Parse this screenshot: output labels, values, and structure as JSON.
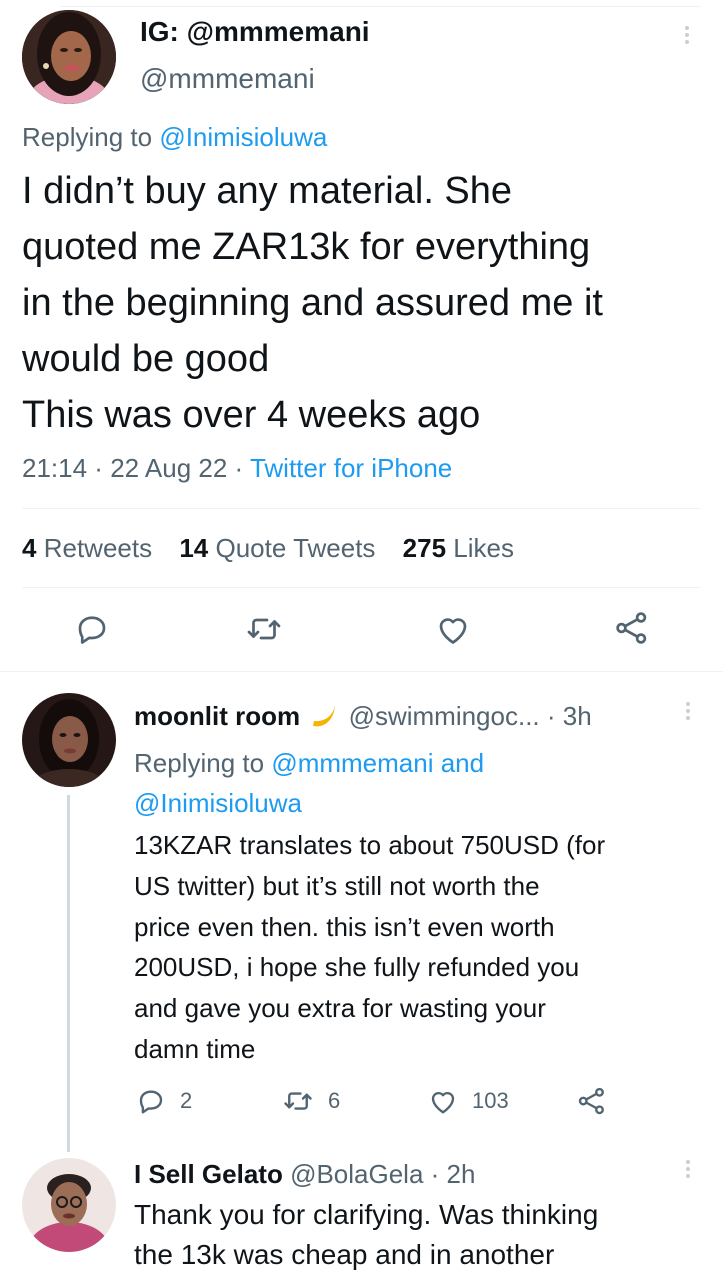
{
  "main_tweet": {
    "display_name": "IG: @mmmemani",
    "handle": "@mmmemani",
    "replying_label": "Replying to",
    "replying_to": "@Inimisioluwa",
    "text_lines": [
      "I didn’t buy any material. She",
      "quoted me ZAR13k for everything",
      "in the beginning and assured me it",
      "would be good",
      "This was over 4 weeks ago"
    ],
    "time": "21:14",
    "date": "22 Aug 22",
    "source": "Twitter for iPhone",
    "stats": {
      "retweets_count": "4",
      "retweets_label": "Retweets",
      "quotes_count": "14",
      "quotes_label": "Quote Tweets",
      "likes_count": "275",
      "likes_label": "Likes"
    },
    "actions": [
      "reply-icon",
      "retweet-icon",
      "like-icon",
      "share-icon"
    ]
  },
  "replies": [
    {
      "display_name": "moonlit room",
      "name_emoji": "crescent-moon-icon",
      "handle": "@swimmingoc...",
      "time": "3h",
      "replying_label": "Replying to",
      "replying_to_line1": "@mmmemani and",
      "replying_to_line2": "@Inimisioluwa",
      "text_lines": [
        "13KZAR translates to about 750USD (for",
        "US twitter) but it’s still not worth the",
        "price even then. this isn’t even worth",
        "200USD, i hope she fully refunded you",
        "and gave you extra for wasting your",
        "damn time"
      ],
      "reply_count": "2",
      "retweet_count": "6",
      "like_count": "103"
    },
    {
      "display_name": "I Sell Gelato",
      "handle": "@BolaGela",
      "time": "2h",
      "text_lines": [
        "Thank you for clarifying. Was thinking",
        "the 13k was cheap and in another"
      ]
    }
  ],
  "colors": {
    "text": "#0f1419",
    "secondary": "#536471",
    "link": "#1d9bf0",
    "divider": "#eff3f4",
    "thread_line": "#cfd9de"
  }
}
